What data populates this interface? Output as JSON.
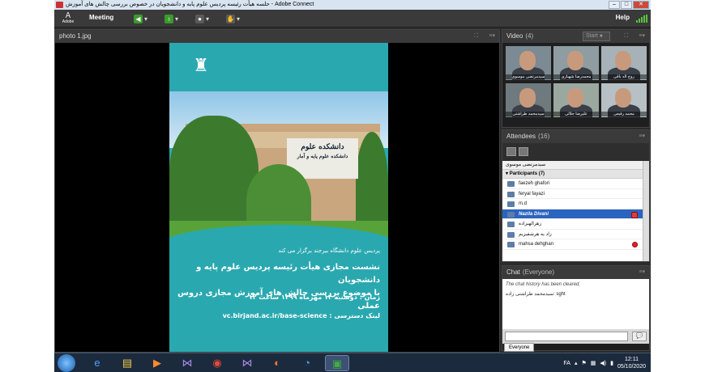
{
  "window": {
    "title": "حلسه هیأت رئیسه پردیس علوم پایه و دانشجویان در خصوص بررسی چالش های آموزش - Adobe Connect"
  },
  "menubar": {
    "logo_text": "Adobe",
    "meeting_label": "Meeting",
    "help_label": "Help"
  },
  "share_pod": {
    "title": "photo 1.jpg",
    "poster": {
      "building_sign_line1": "دانشکده علوم",
      "building_sign_line2": "دانشکده علوم پایه و آمار",
      "host_line": "پردیس علوم دانشگاه بیرجند برگزار می کند",
      "headline_line1": "نشست مجازی هیأت رئیسه پردیس علوم پایه و دانشجویان",
      "headline_line2": "با موضوع بررسی چالش های آموزش مجازی دروس عملی",
      "time_line": "زمان : دوشنبه ۱۴ مهرماه ۱۳۹۹ ساعت ۱۲",
      "link_label": "لینک دسترسی :",
      "link_url": "vc.birjand.ac.ir/base-science"
    }
  },
  "video_pod": {
    "title": "Video",
    "count": "(4)",
    "start_label": "Start",
    "thumbnails": [
      {
        "name": "سیدمرتضی موسوی"
      },
      {
        "name": "محمدرضا شهبازی"
      },
      {
        "name": "روح اله باقی"
      },
      {
        "name": "سیدمحمد طراشتی"
      },
      {
        "name": "علیرضا جلالی"
      },
      {
        "name": "محمد رفیعی"
      }
    ]
  },
  "attendees_pod": {
    "title": "Attendees",
    "count": "(16)",
    "host_name": "سیدمرتضی موسوی",
    "participants_header": "Participants (7)",
    "participants": [
      {
        "name": "faezeh ghafori",
        "selected": false
      },
      {
        "name": "feryal fayazi",
        "selected": false
      },
      {
        "name": "m.d",
        "selected": false
      },
      {
        "name": "Nazila Divani",
        "selected": true
      },
      {
        "name": "زهرالهیزاده",
        "selected": false
      },
      {
        "name": "زاد یه هرشفیزیم",
        "selected": false
      },
      {
        "name": "mahsa dehghan",
        "selected": false
      }
    ]
  },
  "chat_pod": {
    "title": "Chat",
    "scope": "(Everyone)",
    "system_message": "The chat history has been cleared.",
    "message": "سیدمحمد طراشتی زاده: sght",
    "tab_label": "Everyone",
    "send_glyph": "💬"
  },
  "taskbar": {
    "language": "FA",
    "time": "12:11",
    "date": "05/10/2020"
  },
  "colors": {
    "poster_teal": "#2aa8b0",
    "selected_row": "#2b64c0",
    "speaker_green": "#3a9a2b"
  }
}
